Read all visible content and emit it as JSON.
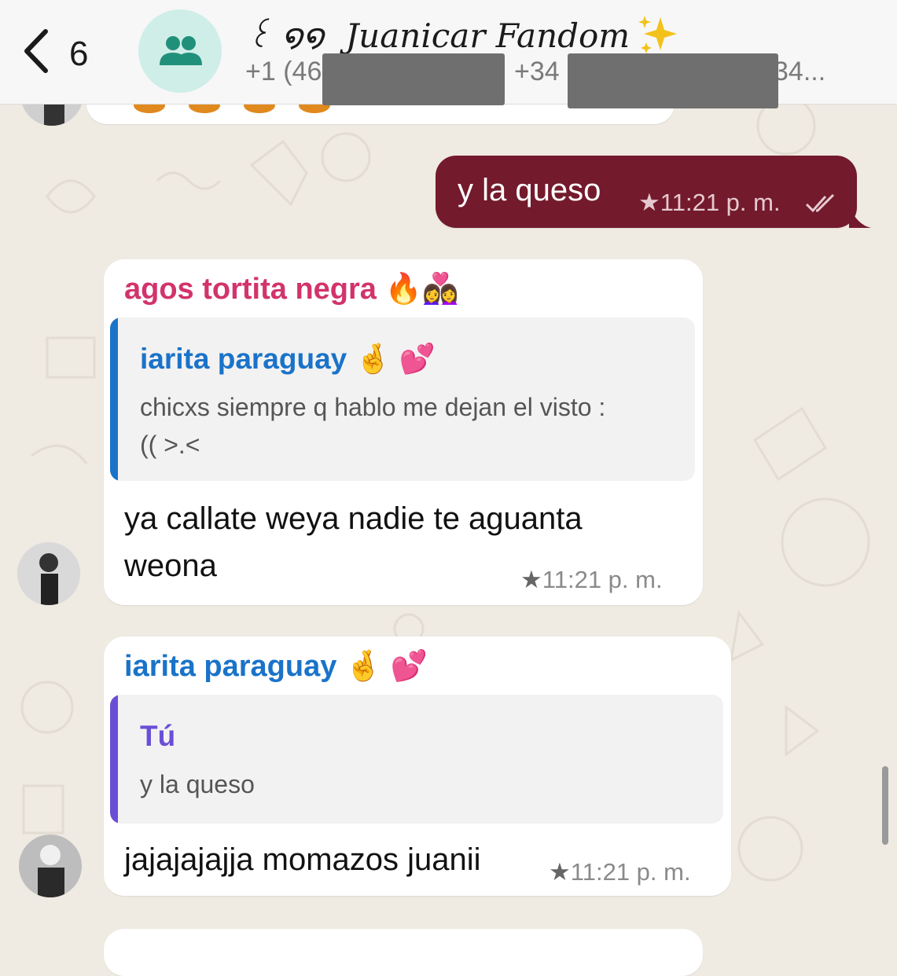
{
  "header": {
    "back_count": "6",
    "group_prefix": "꒰ ໑໑",
    "group_name": "Juanicar Fandom",
    "members": {
      "first": "+1 (46",
      "second": "+34",
      "third": "34..."
    }
  },
  "messages": [
    {
      "id": "out-1",
      "direction": "outgoing",
      "text": "y la queso",
      "time": "11:21 p. m.",
      "starred": true,
      "read_status": "double-check"
    },
    {
      "id": "in-1",
      "direction": "incoming",
      "sender": "agos tortita negra",
      "sender_color": "#d2336b",
      "quoted": {
        "author": "iarita paraguay",
        "author_color": "#1a73c9",
        "text_line1": "chicxs siempre q hablo me dejan el visto :",
        "text_line2": "(( >.<"
      },
      "text_line1": "ya callate weya nadie te aguanta",
      "text_line2": "weona",
      "time": "11:21 p. m.",
      "starred": true
    },
    {
      "id": "in-2",
      "direction": "incoming",
      "sender": "iarita paraguay",
      "sender_color": "#1a73c9",
      "quoted": {
        "author": "Tú",
        "author_color": "#6a4fd6",
        "text": "y la queso"
      },
      "text": "jajajajajja momazos juanii",
      "time": "11:21 p. m.",
      "starred": true
    }
  ],
  "colors": {
    "outgoing_bubble": "#731a2c",
    "background": "#efeae2"
  }
}
